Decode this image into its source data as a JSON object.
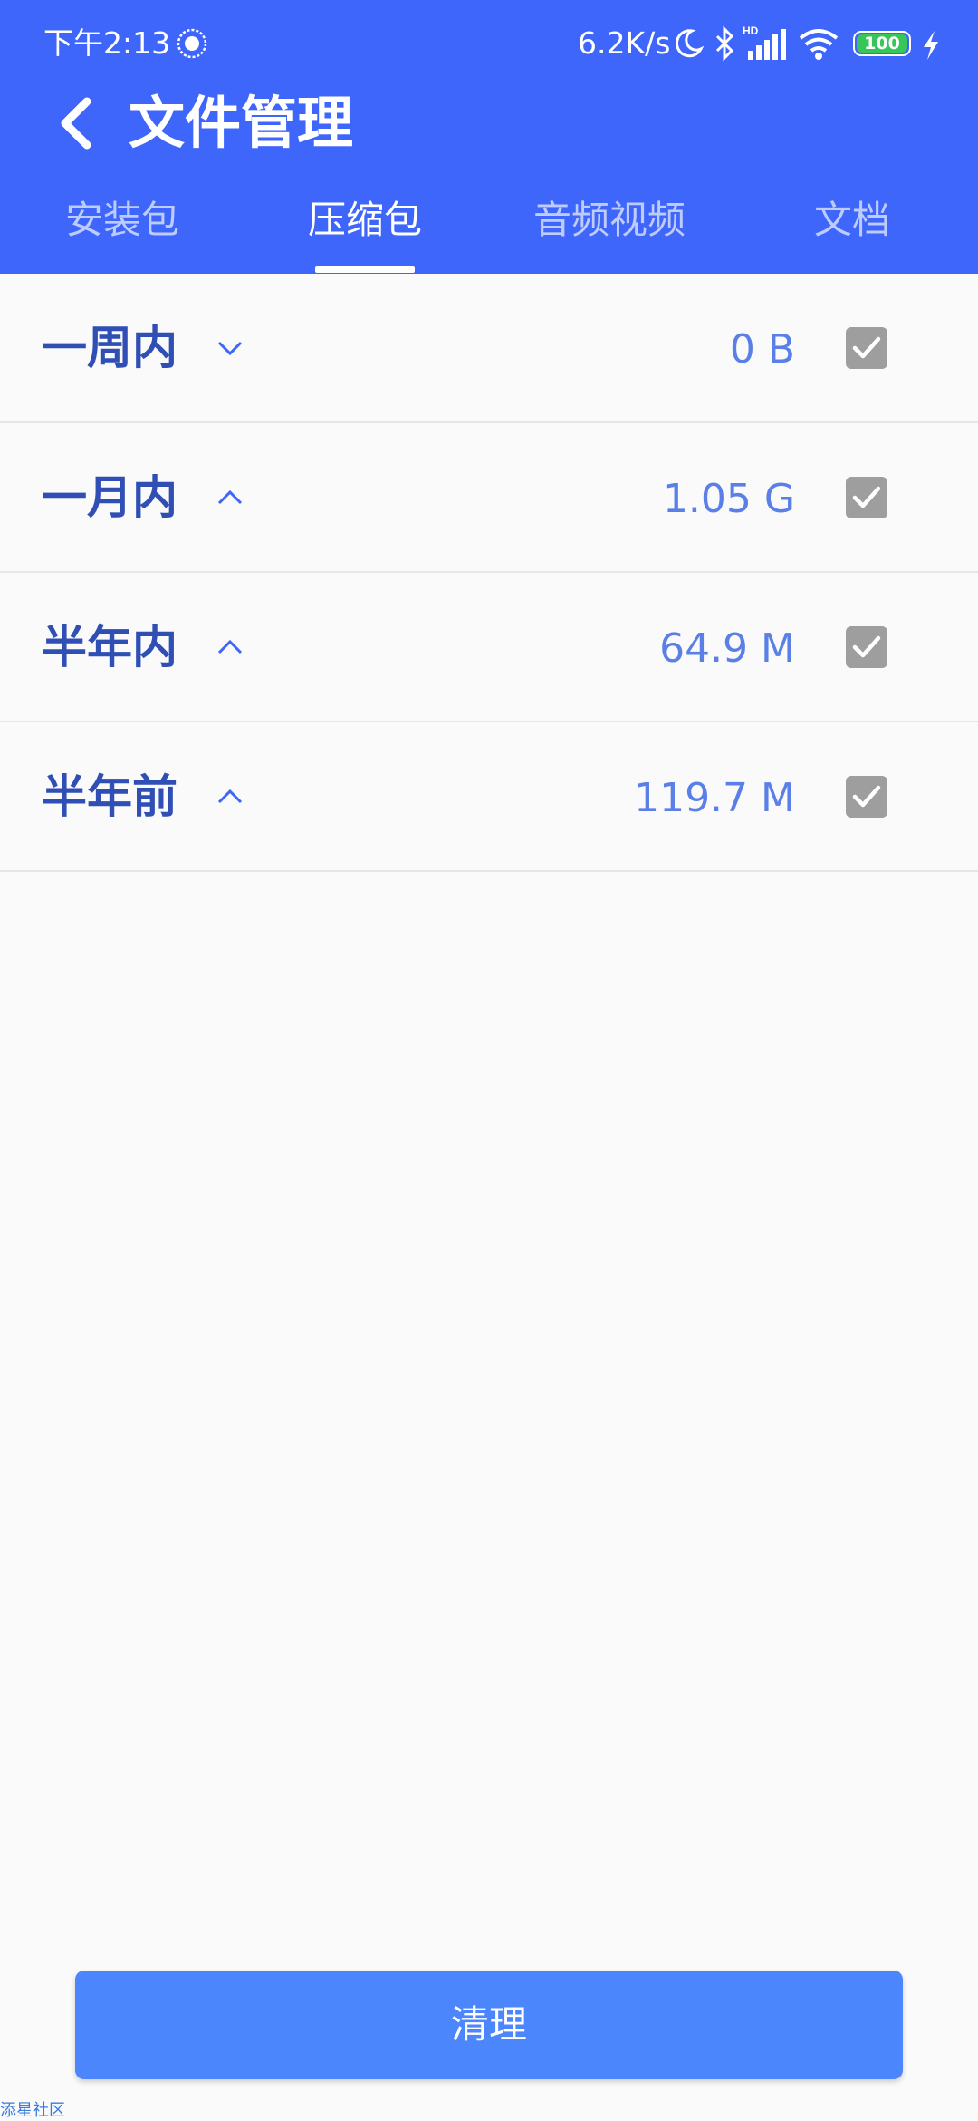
{
  "status_bar": {
    "time": "下午2:13",
    "network_speed": "6.2K/s",
    "battery": "100",
    "icons": [
      "app-notification-icon",
      "moon-icon",
      "bluetooth-icon",
      "hd-signal-icon",
      "wifi-icon",
      "battery-icon",
      "charging-icon"
    ]
  },
  "header": {
    "title": "文件管理",
    "back_icon": "chevron-left-icon",
    "background_color": "#3f66fb"
  },
  "tabs": [
    {
      "label": "安装包",
      "active": false
    },
    {
      "label": "压缩包",
      "active": true
    },
    {
      "label": "音频视频",
      "active": false
    },
    {
      "label": "文档",
      "active": false
    }
  ],
  "groups": [
    {
      "label": "一周内",
      "size": "0 B",
      "expanded_icon": "chevron-down-icon",
      "checked": true
    },
    {
      "label": "一月内",
      "size": "1.05 G",
      "expanded_icon": "chevron-up-icon",
      "checked": true
    },
    {
      "label": "半年内",
      "size": "64.9 M",
      "expanded_icon": "chevron-up-icon",
      "checked": true
    },
    {
      "label": "半年前",
      "size": "119.7 M",
      "expanded_icon": "chevron-up-icon",
      "checked": true
    }
  ],
  "actions": {
    "clean_label": "清理",
    "accent_color": "#4b86fd"
  },
  "watermark": "添星社区"
}
